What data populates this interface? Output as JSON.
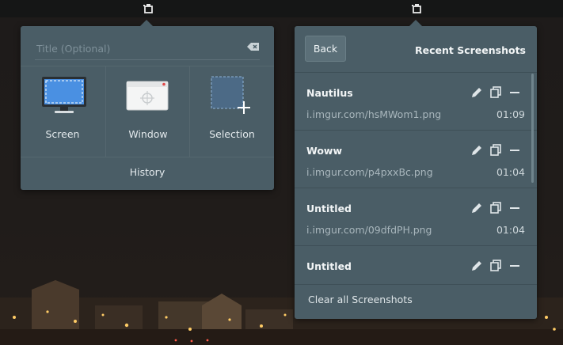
{
  "topbar": {
    "icons": [
      "screenshot-tray-icon",
      "screenshot-tray-icon"
    ]
  },
  "capture": {
    "title_placeholder": "Title (Optional)",
    "clear_icon": "backspace-clear-icon",
    "modes": [
      {
        "label": "Screen",
        "icon": "monitor-icon"
      },
      {
        "label": "Window",
        "icon": "window-icon"
      },
      {
        "label": "Selection",
        "icon": "selection-icon"
      }
    ],
    "history_label": "History"
  },
  "recent": {
    "back_label": "Back",
    "title": "Recent Screenshots",
    "items": [
      {
        "name": "Nautilus",
        "url": "i.imgur.com/hsMWom1.png",
        "time": "01:09"
      },
      {
        "name": "Woww",
        "url": "i.imgur.com/p4pxxBc.png",
        "time": "01:04"
      },
      {
        "name": "Untitled",
        "url": "i.imgur.com/09dfdPH.png",
        "time": "01:04"
      },
      {
        "name": "Untitled",
        "url": "",
        "time": ""
      }
    ],
    "actions": [
      "edit-icon",
      "copy-icon",
      "remove-icon"
    ],
    "clear_all_label": "Clear all Screenshots"
  },
  "colors": {
    "popover_bg": "#4a5d66",
    "accent_blue": "#4a90e2",
    "desktop_bg": "#1c1a19"
  }
}
